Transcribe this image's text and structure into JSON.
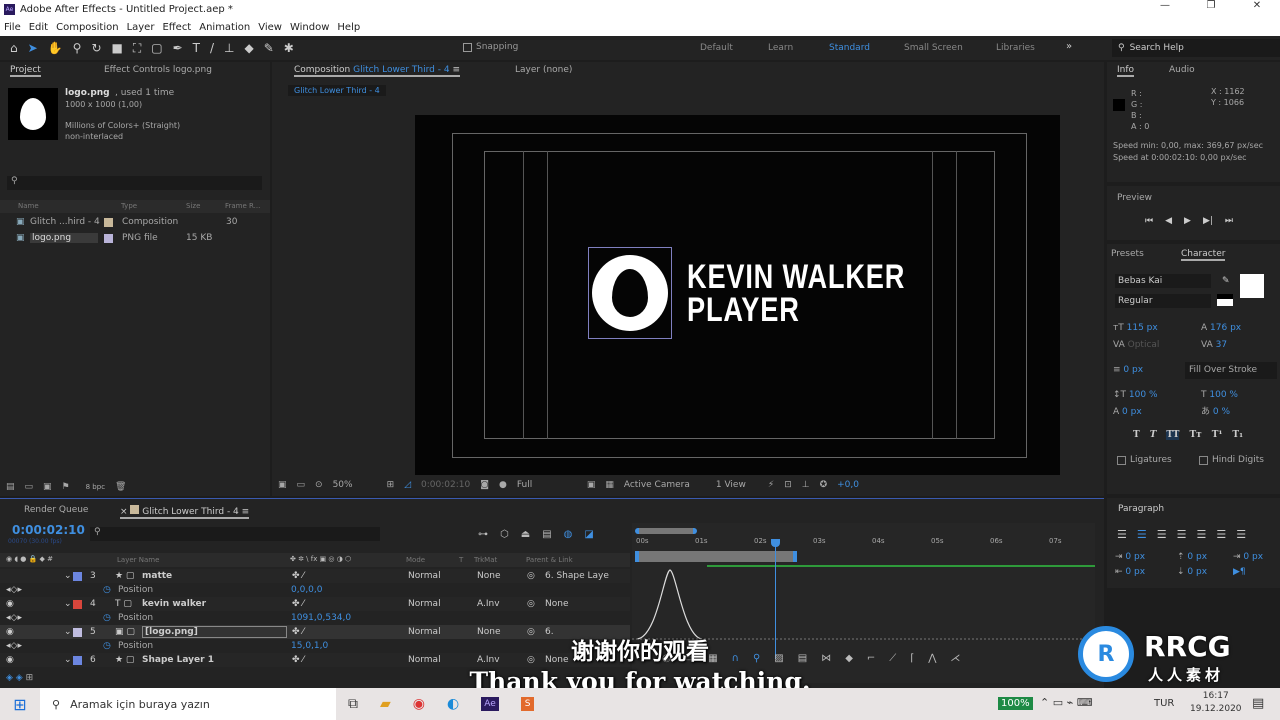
{
  "app": {
    "title": "Adobe After Effects - Untitled Project.aep *",
    "icon": "Ae"
  },
  "menu": [
    "File",
    "Edit",
    "Composition",
    "Layer",
    "Effect",
    "Animation",
    "View",
    "Window",
    "Help"
  ],
  "toolbar": {
    "snapping": "Snapping",
    "workspaces": [
      "Default",
      "Learn",
      "Standard",
      "Small Screen",
      "Libraries"
    ],
    "active_workspace": "Standard",
    "search_placeholder": "Search Help"
  },
  "project": {
    "tab": "Project",
    "effect_tab": "Effect Controls logo.png",
    "asset_name": "logo.png",
    "used": ", used 1 time",
    "dims": "1000 x 1000 (1,00)",
    "colors": "Millions of Colors+ (Straight)",
    "interlace": "non-interlaced",
    "columns": [
      "Name",
      "Type",
      "Size",
      "Frame R..."
    ],
    "items": [
      {
        "name": "Glitch ...hird - 4",
        "type": "Composition",
        "size": "",
        "fps": "30",
        "color": "#c8b89a"
      },
      {
        "name": "logo.png",
        "type": "PNG file",
        "size": "15 KB",
        "fps": "",
        "color": "#b9b3d8"
      }
    ],
    "bpc": "8 bpc"
  },
  "comp": {
    "tab_prefix": "Composition",
    "tab_name": "Glitch Lower Third - 4",
    "layer_tab": "Layer (none)",
    "breadcrumb": "Glitch Lower Third - 4",
    "line1": "KEVIN WALKER",
    "line2": "PLAYER",
    "zoom": "50%",
    "time": "0:00:02:10",
    "resolution": "Full",
    "camera": "Active Camera",
    "views": "1 View",
    "exposure": "+0,0"
  },
  "info": {
    "tab": "Info",
    "audio_tab": "Audio",
    "r": "R :",
    "g": "G :",
    "b": "B :",
    "a": "A : 0",
    "x": "X : 1162",
    "y": "Y : 1066",
    "speed1": "Speed min: 0,00, max: 369,67 px/sec",
    "speed2": "Speed at 0:00:02:10: 0,00 px/sec"
  },
  "preview": {
    "title": "Preview"
  },
  "character": {
    "presets_tab": "Presets",
    "tab": "Character",
    "font": "Bebas Kai",
    "style": "Regular",
    "size": "115 px",
    "leading": "176 px",
    "kerning": "Optical",
    "tracking": "37",
    "stroke": "0 px",
    "stroke_mode": "Fill Over Stroke",
    "vscale": "100 %",
    "hscale": "100 %",
    "baseline": "0 px",
    "tsume": "0 %",
    "ligatures": "Ligatures",
    "hindi": "Hindi Digits"
  },
  "paragraph": {
    "title": "Paragraph",
    "values": [
      "0 px",
      "0 px",
      "0 px",
      "0 px",
      "0 px"
    ]
  },
  "timeline": {
    "render_tab": "Render Queue",
    "comp_tab": "Glitch Lower Third - 4",
    "timecode": "0:00:02:10",
    "frames": "00070 (30.00 fps)",
    "columns": {
      "layer_name": "Layer Name",
      "mode": "Mode",
      "t": "T",
      "trkmat": "TrkMat",
      "parent": "Parent & Link"
    },
    "ruler": [
      "00s",
      "01s",
      "02s",
      "03s",
      "04s",
      "05s",
      "06s",
      "07s"
    ],
    "playhead_seconds": 2.33,
    "layers": [
      {
        "num": "3",
        "type": "star",
        "name": "matte",
        "color": "#6c86e0",
        "mode": "Normal",
        "trkmat": "None",
        "parent": "6. Shape Laye",
        "prop": "Position",
        "value": "0,0,0,0"
      },
      {
        "num": "4",
        "type": "T",
        "name": "kevin walker",
        "color": "#d9463c",
        "mode": "Normal",
        "trkmat": "A.Inv",
        "parent": "None",
        "prop": "Position",
        "value": "1091,0,534,0"
      },
      {
        "num": "5",
        "type": "img",
        "name": "[logo.png]",
        "color": "#c0bde0",
        "mode": "Normal",
        "trkmat": "None",
        "parent": "6.",
        "prop": "Position",
        "value": "15,0,1,0"
      },
      {
        "num": "6",
        "type": "star",
        "name": "Shape Layer 1",
        "color": "#6c86e0",
        "mode": "Normal",
        "trkmat": "A.Inv",
        "parent": "None"
      }
    ]
  },
  "subtitles": {
    "zh": "谢谢你的观看",
    "en": "Thank you for watching."
  },
  "watermark": {
    "logo": "RRCG",
    "sub": "人人素材"
  },
  "taskbar": {
    "search": "Aramak için buraya yazın",
    "battery": "100%",
    "lang": "TUR",
    "time": "16:17",
    "date": "19.12.2020"
  }
}
